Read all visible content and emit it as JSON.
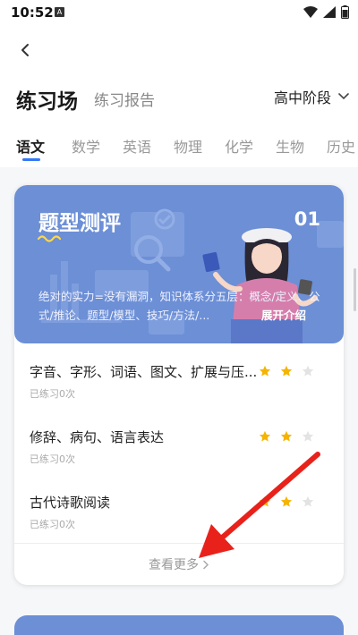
{
  "status_bar": {
    "time": "10:52",
    "notification_badge": "A"
  },
  "header": {
    "title": "练习场",
    "secondary_tab": "练习报告",
    "stage": "高中阶段"
  },
  "subjects": [
    "语文",
    "数学",
    "英语",
    "物理",
    "化学",
    "生物",
    "历史"
  ],
  "active_subject": "语文",
  "card": {
    "banner_title": "题型测评",
    "banner_number": "01",
    "banner_description": "绝对的实力=没有漏洞，知识体系分五层：概念/定义、公式/推论、题型/模型、技巧/方法/...",
    "expand_label": "展开介绍",
    "items": [
      {
        "title": "字音、字形、词语、图文、扩展与压...",
        "subtitle": "已练习0次",
        "stars_filled": 2,
        "stars_total": 3
      },
      {
        "title": "修辞、病句、语言表达",
        "subtitle": "已练习0次",
        "stars_filled": 2,
        "stars_total": 3
      },
      {
        "title": "古代诗歌阅读",
        "subtitle": "已练习0次",
        "stars_filled": 2,
        "stars_total": 3
      }
    ],
    "more_label": "查看更多"
  },
  "colors": {
    "accent": "#3478f6",
    "banner": "#6c8fd6",
    "star_filled": "#f5b400",
    "star_empty": "#e3e3e3",
    "arrow": "#e8221b"
  }
}
